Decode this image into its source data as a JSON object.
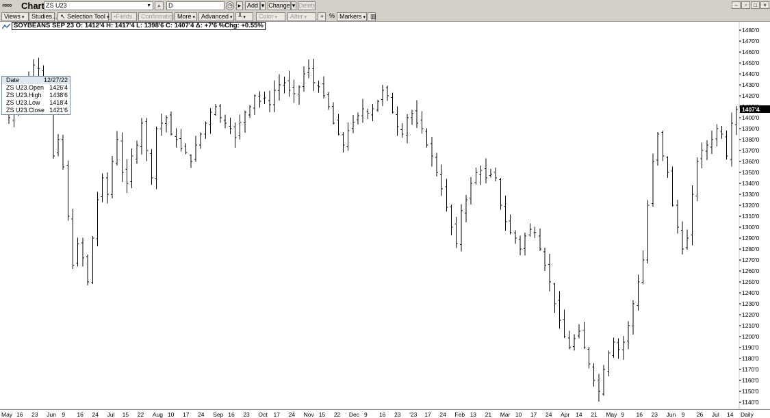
{
  "window": {
    "logo": "∞∞",
    "title": "Chart",
    "symbol_value": "ZS U23",
    "interval_value": "D",
    "add_label": "Add",
    "change_label": "Change",
    "delete_label": "Delete"
  },
  "toolbar": {
    "views": "Views",
    "studies": "Studies...",
    "selection_tool": "Selection Tool",
    "fields": "Fields...",
    "confirmation": "Confirmation",
    "more": "More",
    "advanced": "Advanced",
    "color": "Color",
    "alter": "Alter",
    "percent": "%",
    "markers": "Markers"
  },
  "info": {
    "text": "SOYBEANS SEP 23  O: 1412'4  H: 1417'4  L: 1398'6  C: 1407'4  Δ: +7'6  %Chg: +0.55%"
  },
  "data_window": {
    "rows": [
      {
        "key": "Date",
        "value": "12/27/22"
      },
      {
        "key": "ZS U23.Open",
        "value": "1426'4"
      },
      {
        "key": "ZS U23.High",
        "value": "1438'6"
      },
      {
        "key": "ZS U23.Low",
        "value": "1418'4"
      },
      {
        "key": "ZS U23.Close",
        "value": "1421'6"
      }
    ]
  },
  "colors": {
    "bar": "#000000",
    "last_price_bg": "#000000",
    "last_price_fg": "#ffffff",
    "window_bg": "#d4d0c8"
  },
  "chart_data": {
    "type": "ohlc",
    "symbol": "ZS U23",
    "title": "SOYBEANS SEP 23",
    "interval": "Daily",
    "last_price": "1407'4",
    "ylim": [
      1135,
      1485
    ],
    "y_ticks": [
      "1480'0",
      "1470'0",
      "1460'0",
      "1450'0",
      "1440'0",
      "1430'0",
      "1420'0",
      "1410'0",
      "1400'0",
      "1390'0",
      "1380'0",
      "1370'0",
      "1360'0",
      "1350'0",
      "1340'0",
      "1330'0",
      "1320'0",
      "1310'0",
      "1300'0",
      "1290'0",
      "1280'0",
      "1270'0",
      "1260'0",
      "1250'0",
      "1240'0",
      "1230'0",
      "1220'0",
      "1210'0",
      "1200'0",
      "1190'0",
      "1180'0",
      "1170'0",
      "1160'0",
      "1150'0",
      "1140'0"
    ],
    "x_labels": [
      "May",
      "16",
      "23",
      "Jun",
      "9",
      "16",
      "24",
      "Jul",
      "15",
      "22",
      "Aug",
      "10",
      "17",
      "24",
      "Sep",
      "16",
      "23",
      "Oct",
      "17",
      "24",
      "Nov",
      "15",
      "22",
      "Dec",
      "9",
      "16",
      "23",
      "'23",
      "17",
      "24",
      "Feb",
      "13",
      "21",
      "Mar",
      "10",
      "17",
      "24",
      "Apr",
      "14",
      "21",
      "May",
      "9",
      "16",
      "23",
      "Jun",
      "9",
      "26",
      "Jul",
      "14",
      "Daily"
    ],
    "closes": [
      1405,
      1400,
      1410,
      1420,
      1428,
      1435,
      1448,
      1445,
      1430,
      1415,
      1365,
      1380,
      1355,
      1310,
      1265,
      1285,
      1272,
      1250,
      1290,
      1325,
      1345,
      1330,
      1360,
      1380,
      1350,
      1340,
      1365,
      1375,
      1395,
      1370,
      1345,
      1390,
      1395,
      1400,
      1385,
      1380,
      1372,
      1368,
      1360,
      1375,
      1385,
      1395,
      1405,
      1410,
      1400,
      1395,
      1390,
      1382,
      1396,
      1405,
      1410,
      1420,
      1415,
      1418,
      1412,
      1425,
      1430,
      1432,
      1425,
      1422,
      1428,
      1440,
      1445,
      1432,
      1428,
      1420,
      1410,
      1395,
      1385,
      1375,
      1388,
      1396,
      1402,
      1408,
      1404,
      1408,
      1415,
      1425,
      1420,
      1405,
      1392,
      1385,
      1400,
      1404,
      1395,
      1390,
      1375,
      1365,
      1350,
      1335,
      1318,
      1300,
      1285,
      1315,
      1325,
      1340,
      1350,
      1352,
      1345,
      1348,
      1345,
      1320,
      1305,
      1295,
      1290,
      1280,
      1292,
      1298,
      1295,
      1280,
      1265,
      1250,
      1230,
      1215,
      1200,
      1190,
      1198,
      1205,
      1190,
      1175,
      1160,
      1150,
      1170,
      1185,
      1195,
      1188,
      1195,
      1210,
      1230,
      1250,
      1270,
      1320,
      1360,
      1385,
      1365,
      1350,
      1320,
      1300,
      1280,
      1290,
      1330,
      1360,
      1370,
      1375,
      1380,
      1390,
      1385,
      1365,
      1395,
      1407.5
    ]
  }
}
